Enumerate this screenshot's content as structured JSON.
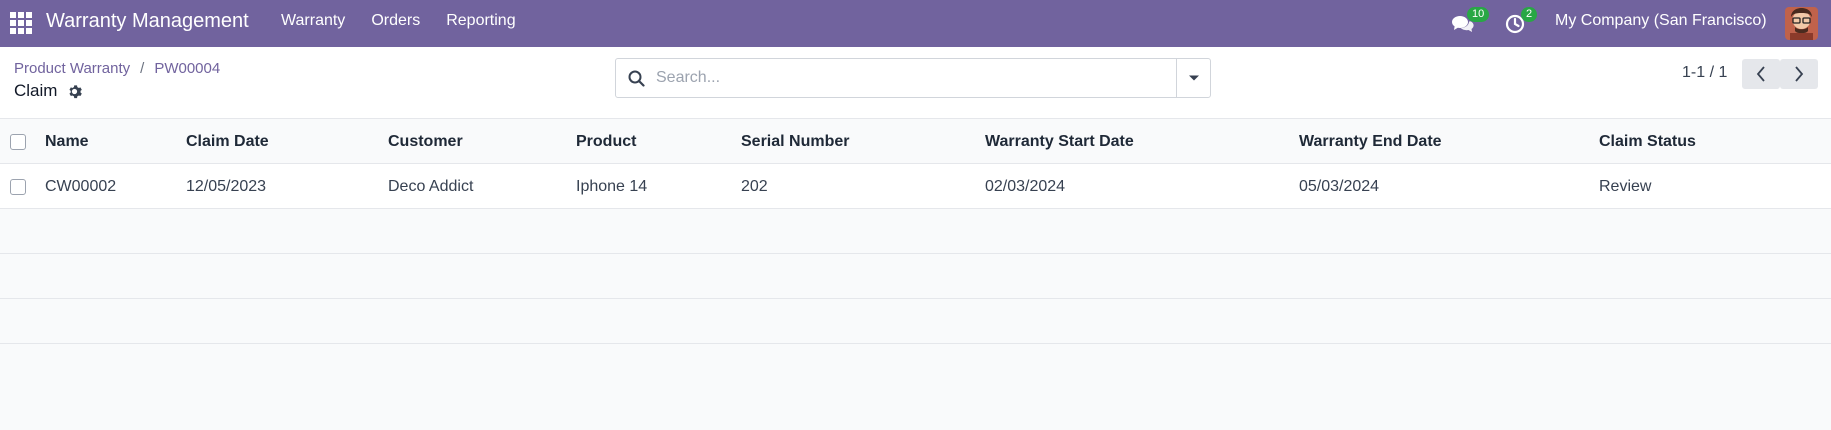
{
  "navbar": {
    "app_name": "Warranty Management",
    "menu": [
      "Warranty",
      "Orders",
      "Reporting"
    ],
    "chat_count": "10",
    "activity_count": "2",
    "company": "My Company (San Francisco)",
    "bg_color": "#71639e"
  },
  "breadcrumb": {
    "items": [
      "Product Warranty",
      "PW00004"
    ],
    "separator": "/"
  },
  "page_title": "Claim",
  "search": {
    "placeholder": "Search...",
    "value": ""
  },
  "pager": {
    "text": "1-1 / 1"
  },
  "table": {
    "columns": [
      "Name",
      "Claim Date",
      "Customer",
      "Product",
      "Serial Number",
      "Warranty Start Date",
      "Warranty End Date",
      "Claim Status"
    ],
    "rows": [
      [
        "CW00002",
        "12/05/2023",
        "Deco Addict",
        "Iphone 14",
        "202",
        "02/03/2024",
        "05/03/2024",
        "Review"
      ]
    ]
  },
  "icons": {
    "apps": "apps-grid-icon",
    "chat": "chat-icon",
    "activity": "clock-icon",
    "gear": "gear-icon",
    "search": "search-icon",
    "dropdown": "caret-down-icon",
    "prev": "chevron-left-icon",
    "next": "chevron-right-icon"
  }
}
